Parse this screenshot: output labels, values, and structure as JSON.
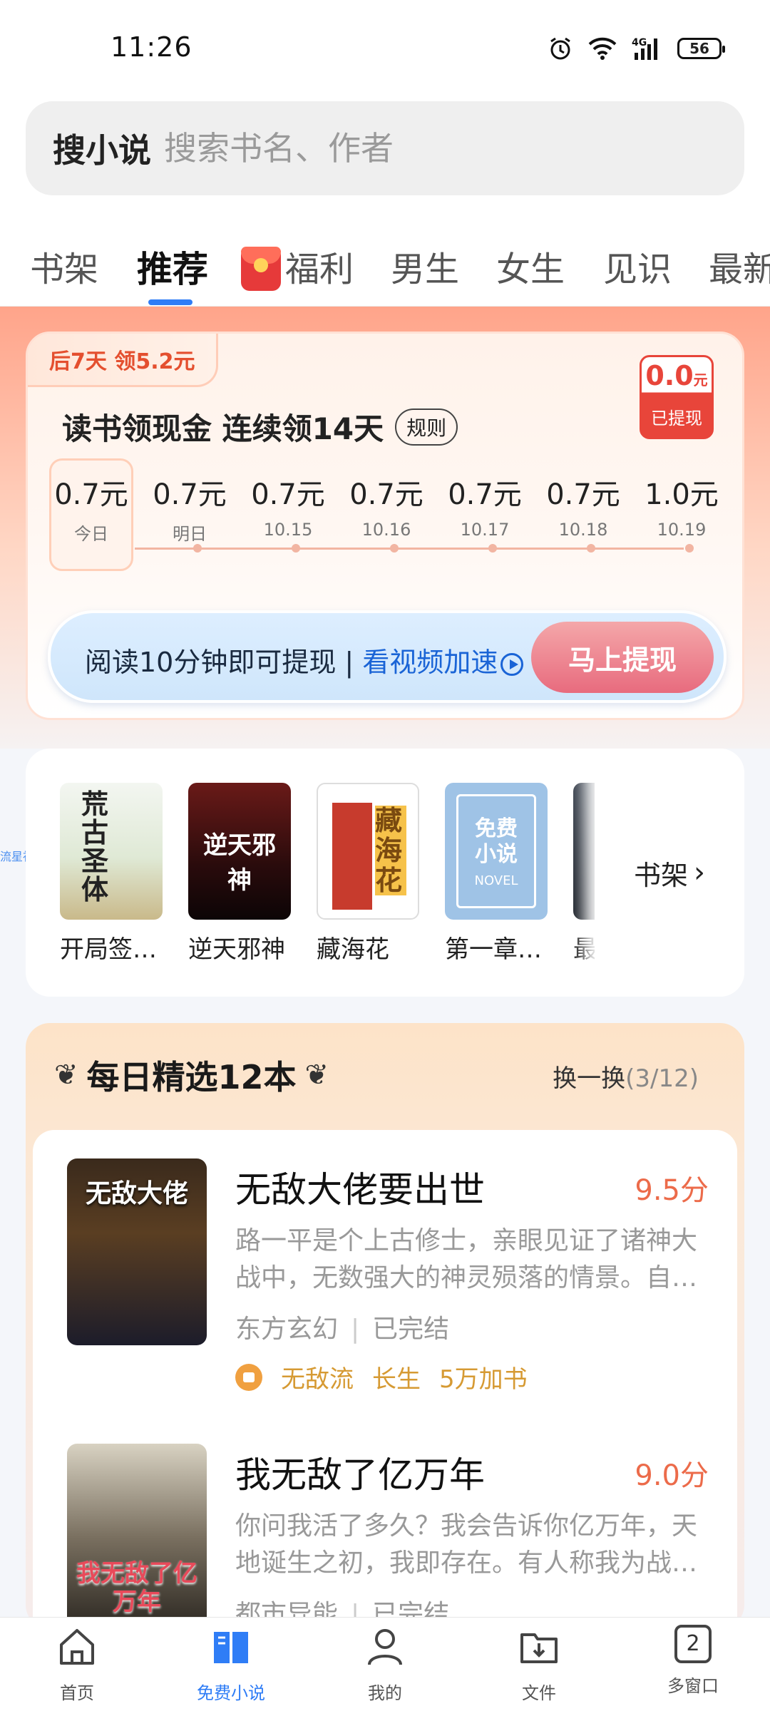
{
  "status": {
    "time": "11:26",
    "battery": "56"
  },
  "search": {
    "lead": "搜小说",
    "placeholder": "搜索书名、作者"
  },
  "tabs": [
    "书架",
    "推荐",
    "福利",
    "男生",
    "女生",
    "见识",
    "最新"
  ],
  "promo": {
    "tag": "后7天 领5.2元",
    "title": "读书领现金 连续领14天",
    "rule": "规则",
    "withdrawn_amount": "0.0",
    "withdrawn_unit": "元",
    "withdrawn_label": "已提现",
    "days": [
      {
        "value": "0.7元",
        "date": "今日"
      },
      {
        "value": "0.7元",
        "date": "明日"
      },
      {
        "value": "0.7元",
        "date": "10.15"
      },
      {
        "value": "0.7元",
        "date": "10.16"
      },
      {
        "value": "0.7元",
        "date": "10.17"
      },
      {
        "value": "0.7元",
        "date": "10.18"
      },
      {
        "value": "1.0元",
        "date": "10.19"
      }
    ],
    "tip": "阅读10分钟即可提现 | ",
    "speed_link": "看视频加速",
    "button": "马上提现"
  },
  "shelf": {
    "side_tag": "流星社区",
    "books": [
      {
        "title": "开局签…",
        "cover_text": "荒古圣体"
      },
      {
        "title": "逆天邪神",
        "cover_text": "逆天邪神"
      },
      {
        "title": "藏海花",
        "cover_text": "藏海花"
      },
      {
        "title": "第一章…",
        "cover_text": "免费小说",
        "cover_sub": "NOVEL"
      },
      {
        "title": "最"
      }
    ],
    "link": "书架"
  },
  "daily": {
    "title": "每日精选12本",
    "refresh": "换一换",
    "refresh_count": "(3/12)",
    "items": [
      {
        "name": "无敌大佬要出世",
        "score": "9.5分",
        "desc": "路一平是个上古修士，亲眼见证了诸神大战中，无数强大的神灵殒落的情景。自…",
        "genre": "东方玄幻",
        "status": "已完结",
        "tags": [
          "无敌流",
          "长生",
          "5万加书"
        ],
        "cover_text": "无敌大佬"
      },
      {
        "name": "我无敌了亿万年",
        "score": "9.0分",
        "desc": "你问我活了多久？我会告诉你亿万年，天地诞生之初，我即存在。有人称我为战…",
        "genre": "都市异能",
        "status": "已完结",
        "cover_text": "我无敌了亿万年"
      }
    ]
  },
  "nav": [
    {
      "label": "首页"
    },
    {
      "label": "免费小说",
      "active": true
    },
    {
      "label": "我的"
    },
    {
      "label": "文件"
    },
    {
      "label": "多窗口",
      "badge": "2"
    }
  ],
  "colors": {
    "accent": "#2f7df6",
    "price_red": "#e8453a",
    "score": "#ec6b4a",
    "tag_gold": "#d69a33"
  }
}
